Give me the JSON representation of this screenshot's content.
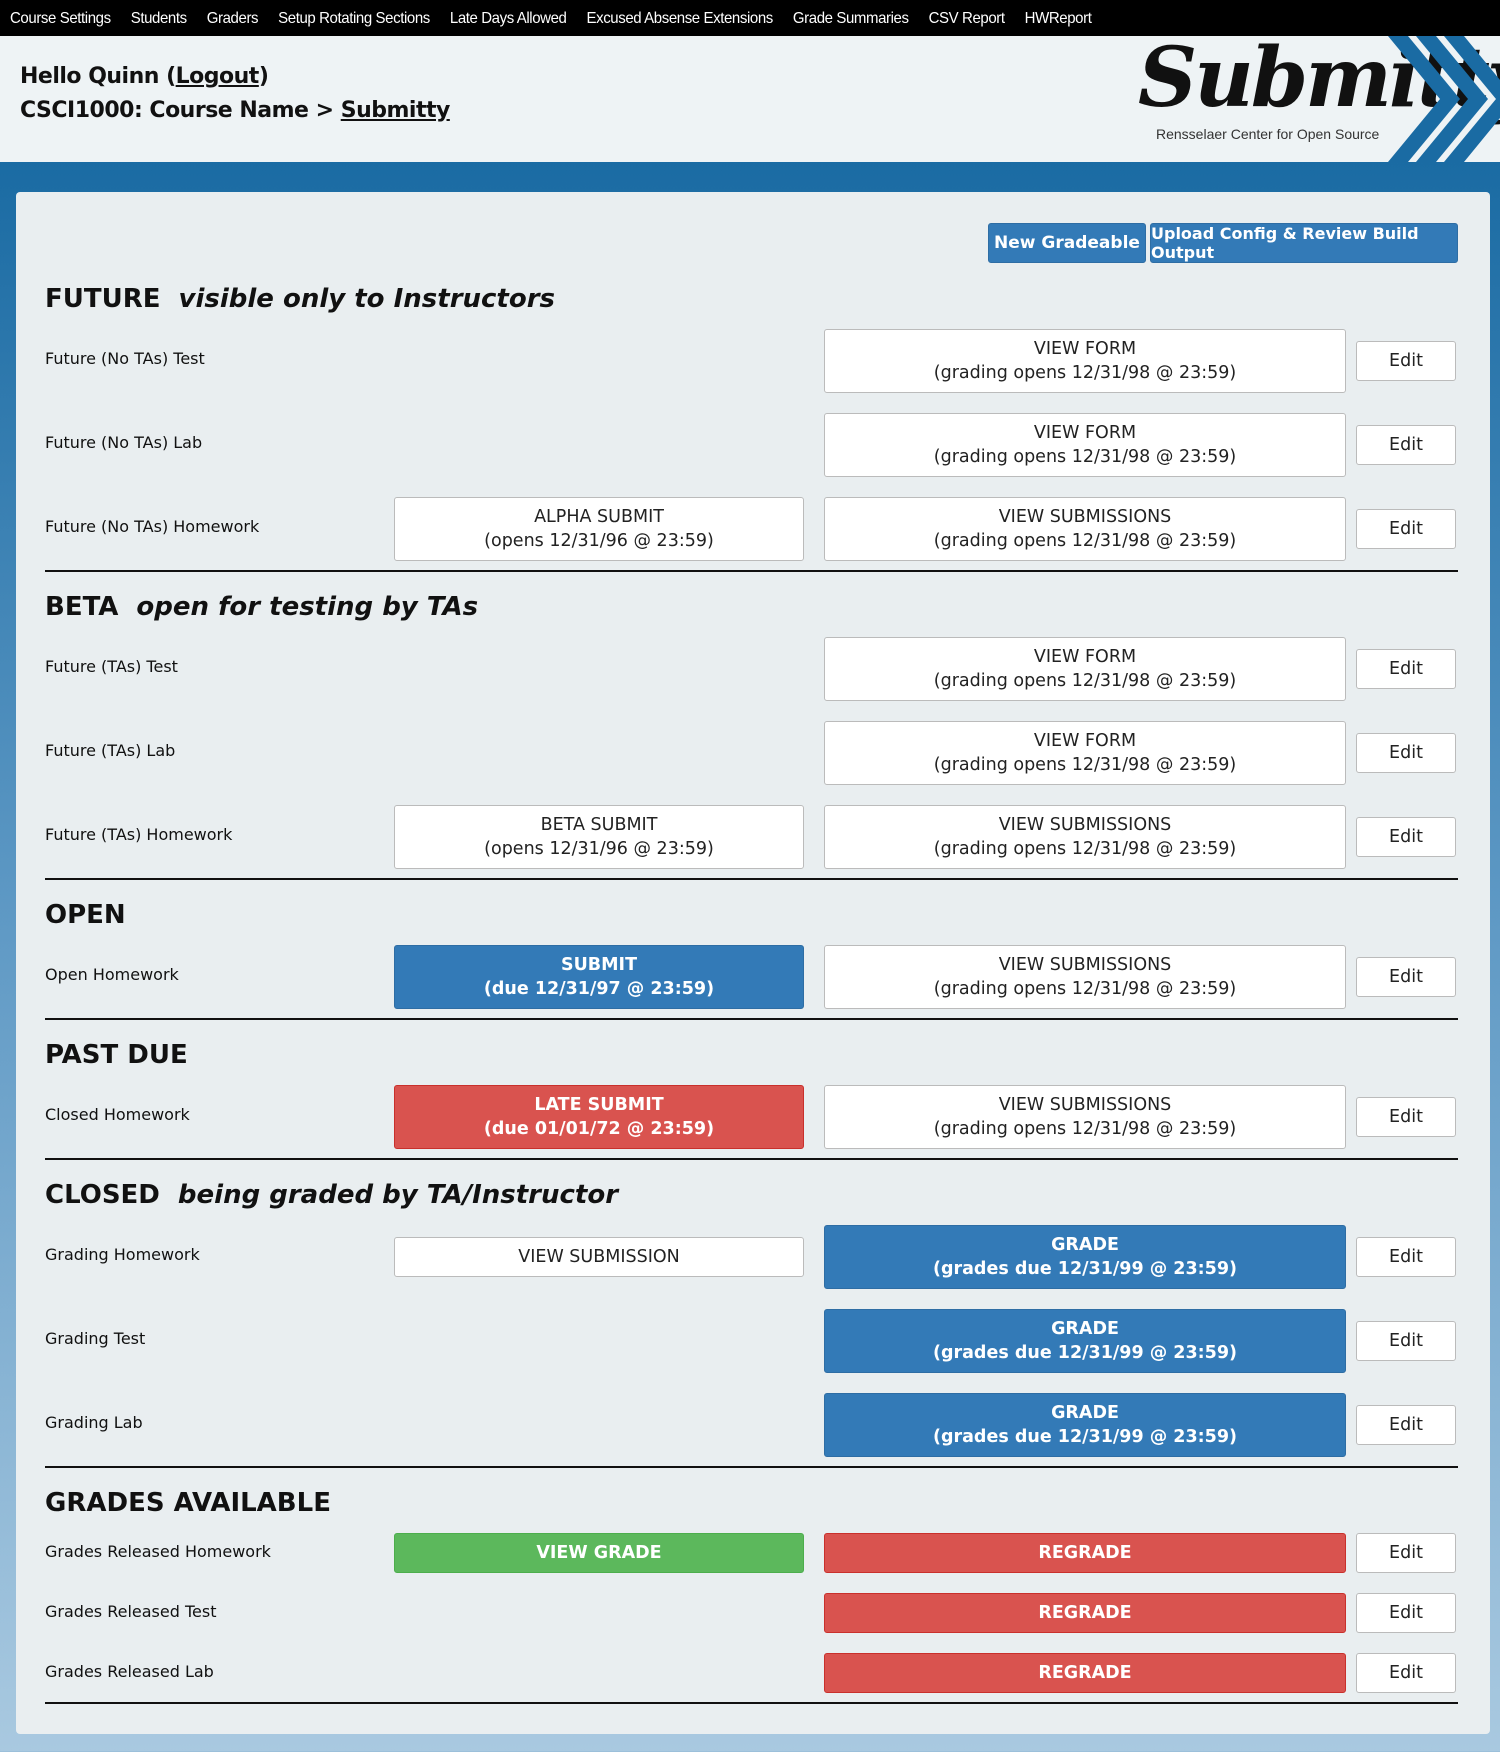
{
  "nav": [
    "Course Settings",
    "Students",
    "Graders",
    "Setup Rotating Sections",
    "Late Days Allowed",
    "Excused Absense Extensions",
    "Grade Summaries",
    "CSV Report",
    "HWReport"
  ],
  "header": {
    "hello": "Hello Quinn (",
    "logout": "Logout",
    "hello_end": ")",
    "course": "CSCI1000: Course Name > ",
    "submitty_link": "Submitty"
  },
  "logo": {
    "word": "Submitty",
    "sub": "Rensselaer Center for Open Source"
  },
  "buttons": {
    "new_gradeable": "New Gradeable",
    "upload_config": "Upload Config & Review Build Output"
  },
  "edit_label": "Edit",
  "sections": {
    "future": {
      "title": "FUTURE",
      "subtitle": "visible only to Instructors",
      "rows": [
        {
          "label": "Future (No TAs) Test",
          "b2a": "VIEW FORM",
          "b2b": "(grading opens 12/31/98 @ 23:59)"
        },
        {
          "label": "Future (No TAs) Lab",
          "b2a": "VIEW FORM",
          "b2b": "(grading opens 12/31/98 @ 23:59)"
        },
        {
          "label": "Future (No TAs) Homework",
          "b1a": "ALPHA SUBMIT",
          "b1b": "(opens 12/31/96 @ 23:59)",
          "b2a": "VIEW SUBMISSIONS",
          "b2b": "(grading opens 12/31/98 @ 23:59)"
        }
      ]
    },
    "beta": {
      "title": "BETA",
      "subtitle": "open for testing by TAs",
      "rows": [
        {
          "label": "Future (TAs) Test",
          "b2a": "VIEW FORM",
          "b2b": "(grading opens 12/31/98 @ 23:59)"
        },
        {
          "label": "Future (TAs) Lab",
          "b2a": "VIEW FORM",
          "b2b": "(grading opens 12/31/98 @ 23:59)"
        },
        {
          "label": "Future (TAs) Homework",
          "b1a": "BETA SUBMIT",
          "b1b": "(opens 12/31/96 @ 23:59)",
          "b2a": "VIEW SUBMISSIONS",
          "b2b": "(grading opens 12/31/98 @ 23:59)"
        }
      ]
    },
    "open": {
      "title": "OPEN",
      "rows": [
        {
          "label": "Open Homework",
          "b1a": "SUBMIT",
          "b1b": "(due 12/31/97 @ 23:59)",
          "b2a": "VIEW SUBMISSIONS",
          "b2b": "(grading opens 12/31/98 @ 23:59)"
        }
      ]
    },
    "pastdue": {
      "title": "PAST DUE",
      "rows": [
        {
          "label": "Closed Homework",
          "b1a": "LATE SUBMIT",
          "b1b": "(due 01/01/72 @ 23:59)",
          "b2a": "VIEW SUBMISSIONS",
          "b2b": "(grading opens 12/31/98 @ 23:59)"
        }
      ]
    },
    "closed": {
      "title": "CLOSED",
      "subtitle": "being graded by TA/Instructor",
      "rows": [
        {
          "label": "Grading Homework",
          "b1a": "VIEW SUBMISSION",
          "b2a": "GRADE",
          "b2b": "(grades due 12/31/99 @ 23:59)"
        },
        {
          "label": "Grading Test",
          "b2a": "GRADE",
          "b2b": "(grades due 12/31/99 @ 23:59)"
        },
        {
          "label": "Grading Lab",
          "b2a": "GRADE",
          "b2b": "(grades due 12/31/99 @ 23:59)"
        }
      ]
    },
    "available": {
      "title": "GRADES AVAILABLE",
      "rows": [
        {
          "label": "Grades Released Homework",
          "b1a": "VIEW GRADE",
          "b2a": "REGRADE"
        },
        {
          "label": "Grades Released Test",
          "b2a": "REGRADE"
        },
        {
          "label": "Grades Released Lab",
          "b2a": "REGRADE"
        }
      ]
    }
  },
  "colors": {
    "blue": "#337ab7",
    "red": "#d9534f",
    "green": "#5cb85c",
    "nav_bg": "#000000"
  }
}
